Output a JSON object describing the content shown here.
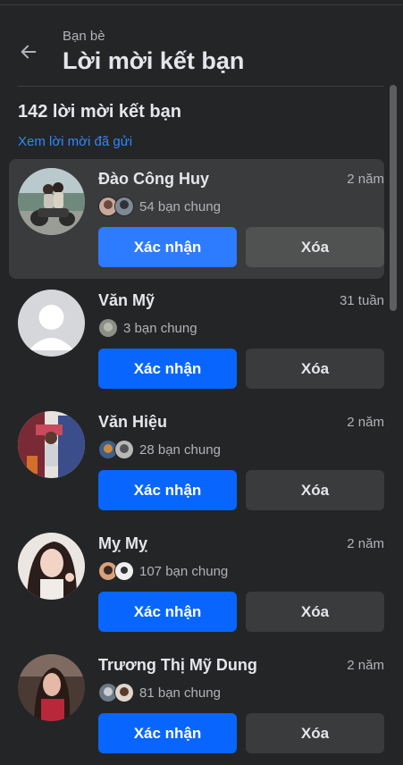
{
  "header": {
    "subtitle": "Bạn bè",
    "title": "Lời mời kết bạn"
  },
  "summary": {
    "count_label": "142 lời mời kết bạn",
    "sent_link": "Xem lời mời đã gửi"
  },
  "requests": [
    {
      "name": "Đào Công Huy",
      "time": "2 năm",
      "mutual": "54 bạn chung",
      "confirm": "Xác nhận",
      "delete": "Xóa"
    },
    {
      "name": "Văn Mỹ",
      "time": "31 tuần",
      "mutual": "3 bạn chung",
      "confirm": "Xác nhận",
      "delete": "Xóa"
    },
    {
      "name": "Văn Hiệu",
      "time": "2 năm",
      "mutual": "28 bạn chung",
      "confirm": "Xác nhận",
      "delete": "Xóa"
    },
    {
      "name": "Mỵ Mỵ",
      "time": "2 năm",
      "mutual": "107 bạn chung",
      "confirm": "Xác nhận",
      "delete": "Xóa"
    },
    {
      "name": "Trương Thị Mỹ Dung",
      "time": "2 năm",
      "mutual": "81 bạn chung",
      "confirm": "Xác nhận",
      "delete": "Xóa"
    }
  ],
  "colors": {
    "background": "#242526",
    "primary_button": "#0866ff",
    "secondary_button": "#3a3b3c",
    "link": "#2d88ff"
  }
}
